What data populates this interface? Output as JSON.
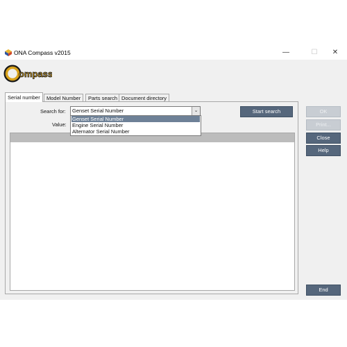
{
  "window": {
    "title": "ONA Compass v2015",
    "logo_text": "Compass"
  },
  "titlebar": {
    "minimize": "—",
    "maximize": "☐",
    "close": "✕"
  },
  "tabs": [
    {
      "label": "Serial number",
      "active": true
    },
    {
      "label": "Model Number",
      "active": false
    },
    {
      "label": "Parts search",
      "active": false
    },
    {
      "label": "Document directory",
      "active": false
    }
  ],
  "form": {
    "search_for_label": "Search for:",
    "value_label": "Value:",
    "selected": "Genset Serial Number",
    "options": [
      "Genset Serial Number",
      "Engine Serial Number",
      "Alternator Serial Number"
    ]
  },
  "buttons": {
    "start_search": "Start search",
    "ok": "OK",
    "print": "Print...",
    "close": "Close",
    "help": "Help",
    "end": "End"
  },
  "colors": {
    "button": "#56677c",
    "selection": "#6e8197",
    "logo_gold": "#d9a21b"
  }
}
